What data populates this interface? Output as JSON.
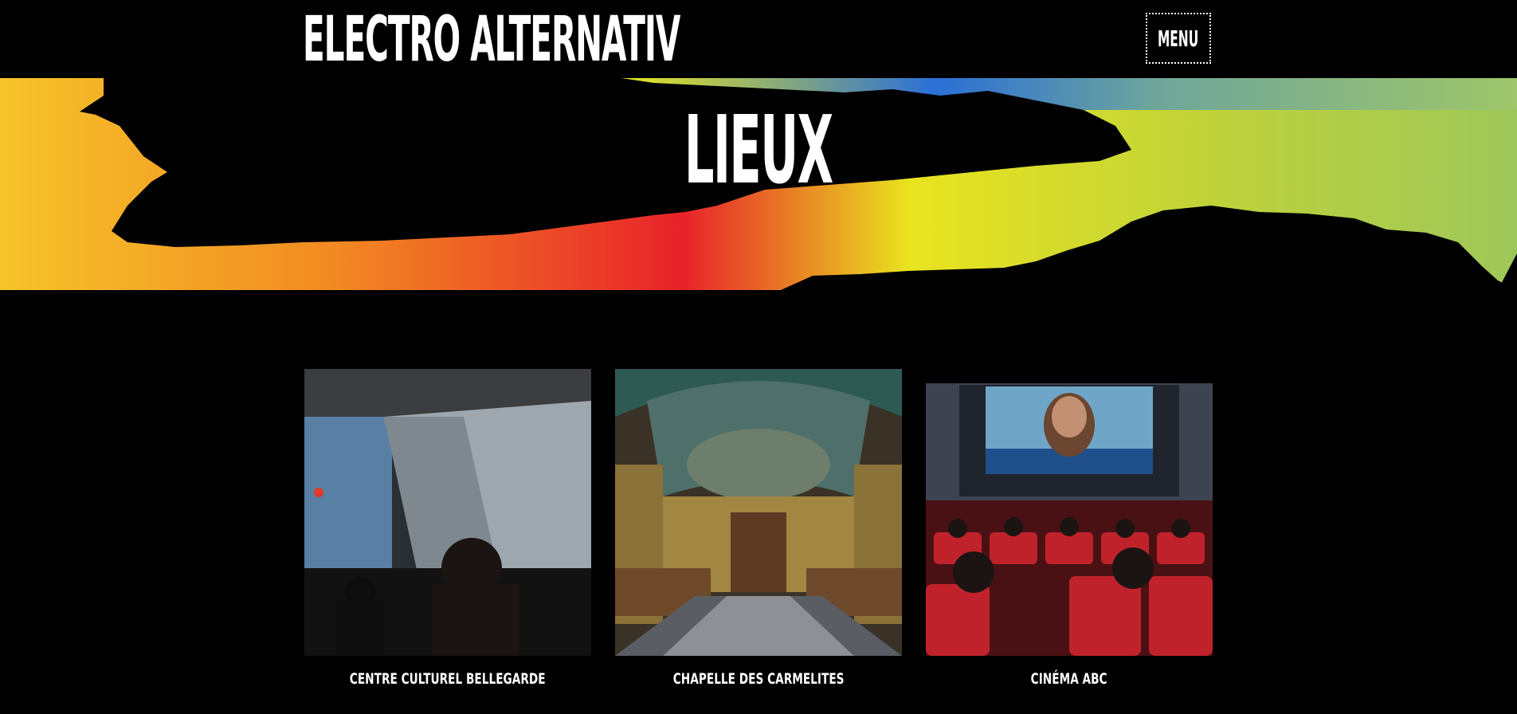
{
  "header": {
    "brand": "ELECTRO ALTERNATIV",
    "menu_label": "MENU"
  },
  "hero": {
    "title": "LIEUX"
  },
  "venues": [
    {
      "name": "CENTRE CULTUREL BELLEGARDE"
    },
    {
      "name": "CHAPELLE DES CARMELITES"
    },
    {
      "name": "CINÉMA ABC"
    }
  ],
  "colors": {
    "background": "#000000",
    "text": "#ffffff",
    "gradient": [
      "#f3c12a",
      "#f07a1e",
      "#e8222a",
      "#e8e61e",
      "#9ec75a",
      "#7fb09a",
      "#2a6fd6"
    ]
  }
}
